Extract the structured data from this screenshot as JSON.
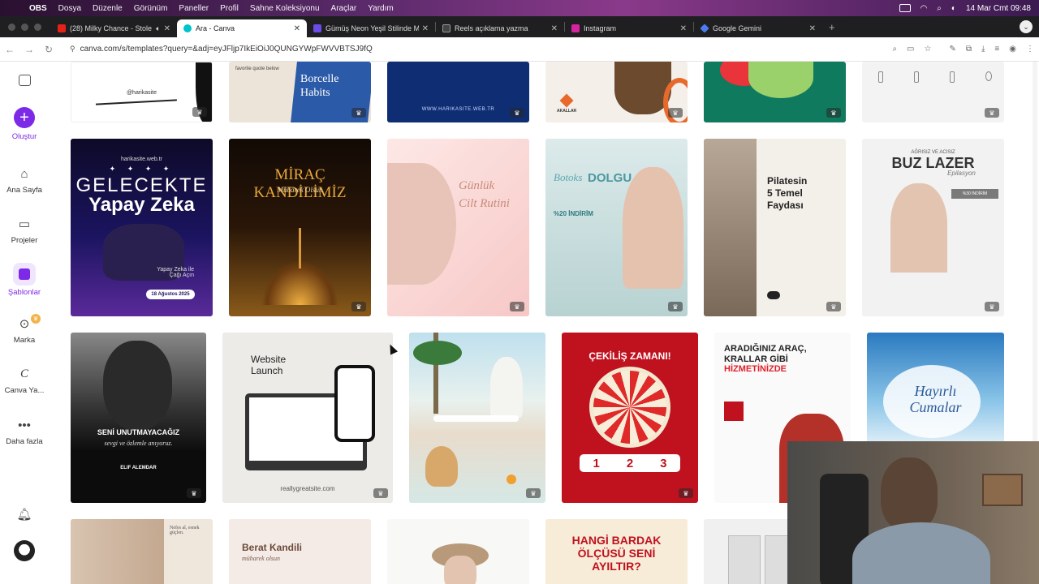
{
  "menubar": {
    "app": "OBS",
    "items": [
      "Dosya",
      "Düzenle",
      "Görünüm",
      "Paneller",
      "Profil",
      "Sahne Koleksiyonu",
      "Araçlar",
      "Yardım"
    ],
    "datetime": "14 Mar Cmt  09:48"
  },
  "tabs": [
    {
      "title": "(28) Milky Chance - Stole",
      "favicon_color": "#e62117"
    },
    {
      "title": "Ara - Canva",
      "favicon_color": "#00c4cc"
    },
    {
      "title": "Gümüş Neon Yeşil Stilinde M",
      "favicon_color": "#6b4ce6"
    },
    {
      "title": "Reels açıklama yazma",
      "favicon_color": "#444444"
    },
    {
      "title": "Instagram",
      "favicon_color": "#d6249f"
    },
    {
      "title": "Google Gemini",
      "favicon_color": "#4a7cf0"
    }
  ],
  "address": {
    "url": "canva.com/s/templates?query=&adj=eyJFljp7IkEiOiJ0QUNGYWpFWVVBTSJ9fQ"
  },
  "sidebar": {
    "create": "Oluştur",
    "items": [
      "Ana Sayfa",
      "Projeler",
      "Şablonlar",
      "Marka",
      "Canva Ya...",
      "Daha fazla"
    ]
  },
  "templates": {
    "row0": {
      "c1": "@harikasite",
      "c2a": "favorite quote below",
      "c2b": "Borcelle Habits",
      "c3": "WWW.HARIKASITE.WEB.TR",
      "c4": "AKALLAR"
    },
    "row1": {
      "c1a": "harikasite.web.tr",
      "c1b": "GELECEKTE",
      "c1c": "Yapay Zeka",
      "c1d": "Yapay Zeka ile Çağı Açın",
      "c1e": "18 Ağustos 2025",
      "c2a": "MİRAÇ KANDİLİMİZ",
      "c2b": "Mübarek Olsun",
      "c3a": "Günlük",
      "c3b": "Cilt Rutini",
      "c4a": "Botoks",
      "c4b": "DOLGU",
      "c4c": "%20 İNDİRİM",
      "c5a": "Pilatesin",
      "c5b": "5 Temel",
      "c5c": "Faydası",
      "c6a": "AĞRISIZ VE ACISIZ",
      "c6b": "BUZ LAZER",
      "c6c": "Epilasyon",
      "c6d": "%30 İNDİRİM"
    },
    "row2": {
      "c1a": "SENİ UNUTMAYACAĞIZ",
      "c1b": "sevgi ve özlemle anıyoruz.",
      "c1c": "ELIF ALEMDAR",
      "c2a": "Website",
      "c2b": "Launch",
      "c2c": "reallygreatsite.com",
      "c4": "ÇEKİLİŞ ZAMANI!",
      "c5a": "ARADIĞINIZ ARAÇ,",
      "c5b": "KRALLAR GİBİ",
      "c5c": "HİZMETİNİZDE",
      "c6a": "Hayırlı",
      "c6b": "Cumalar"
    },
    "row3": {
      "c1": "Nefes al, esnek güçlen.",
      "c2a": "Berat Kandili",
      "c2b": "mübarek olsun",
      "c4a": "HANGİ BARDAK",
      "c4b": "ÖLÇÜSÜ SENİ",
      "c4c": "AYILTIR?"
    }
  }
}
